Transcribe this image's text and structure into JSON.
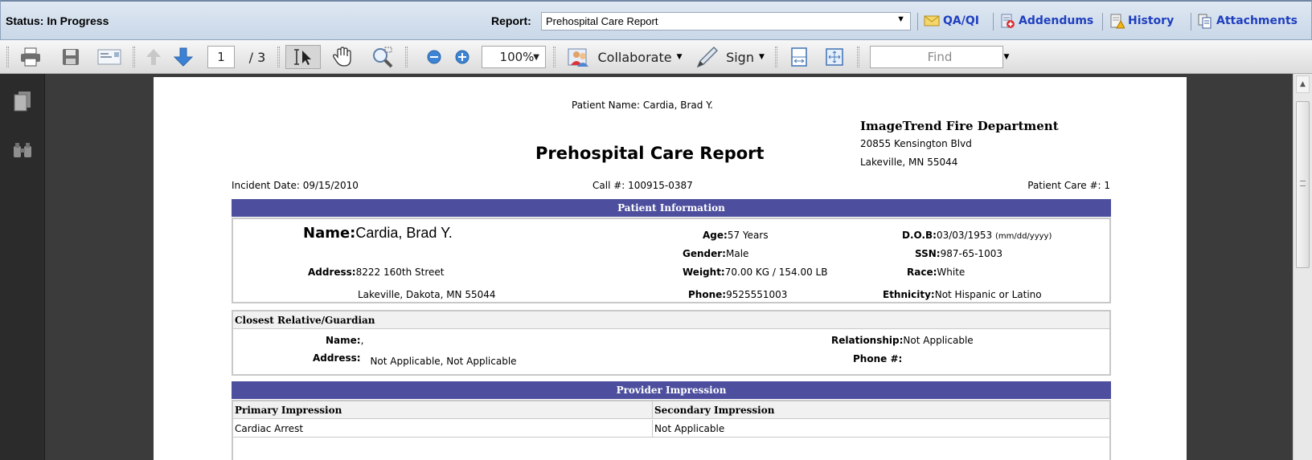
{
  "statusbar": {
    "status_text": "Status: In Progress",
    "report_label": "Report:",
    "report_value": "Prehospital Care Report",
    "links": {
      "qa": "QA/QI",
      "addendums": "Addendums",
      "history": "History",
      "attachments": "Attachments"
    }
  },
  "toolbar": {
    "page_current": "1",
    "page_total": "/ 3",
    "zoom": "100%",
    "collaborate": "Collaborate",
    "sign": "Sign",
    "find_placeholder": "Find"
  },
  "report": {
    "patient_name_header": "Patient Name: Cardia, Brad Y.",
    "title": "Prehospital Care Report",
    "department": "ImageTrend Fire Department",
    "address_line1": "20855 Kensington Blvd",
    "address_line2": "Lakeville, MN 55044",
    "incident_date": "Incident Date: 09/15/2010",
    "call_number": "Call #: 100915-0387",
    "patient_care_number": "Patient Care #: 1",
    "patient_info": {
      "section_title": "Patient Information",
      "name_label": "Name:",
      "name_value": "Cardia, Brad Y.",
      "address_label": "Address:",
      "address_line1": "8222 160th Street",
      "address_line2": "Lakeville, Dakota, MN 55044",
      "age_label": "Age:",
      "age_value": "57 Years",
      "gender_label": "Gender:",
      "gender_value": "Male",
      "weight_label": "Weight:",
      "weight_value": "70.00 KG / 154.00 LB",
      "phone_label": "Phone:",
      "phone_value": "9525551003",
      "dob_label": "D.O.B:",
      "dob_value": "03/03/1953",
      "dob_format": "(mm/dd/yyyy)",
      "ssn_label": "SSN:",
      "ssn_value": "987-65-1003",
      "race_label": "Race:",
      "race_value": "White",
      "ethnicity_label": "Ethnicity:",
      "ethnicity_value": "Not Hispanic or Latino"
    },
    "relative": {
      "section_title": "Closest Relative/Guardian",
      "name_label": "Name:",
      "name_value": ",",
      "address_label": "Address:",
      "address_value": "Not Applicable, Not Applicable",
      "relationship_label": "Relationship:",
      "relationship_value": "Not Applicable",
      "phone_label": "Phone #:",
      "phone_value": ""
    },
    "impression": {
      "section_title": "Provider Impression",
      "primary_header": "Primary Impression",
      "secondary_header": "Secondary Impression",
      "primary_value": "Cardiac Arrest",
      "secondary_value": "Not Applicable"
    }
  },
  "colors": {
    "section_bar": "#4d4f9e",
    "link": "#1f3fbf",
    "status_bar": "#c9d7e7"
  }
}
